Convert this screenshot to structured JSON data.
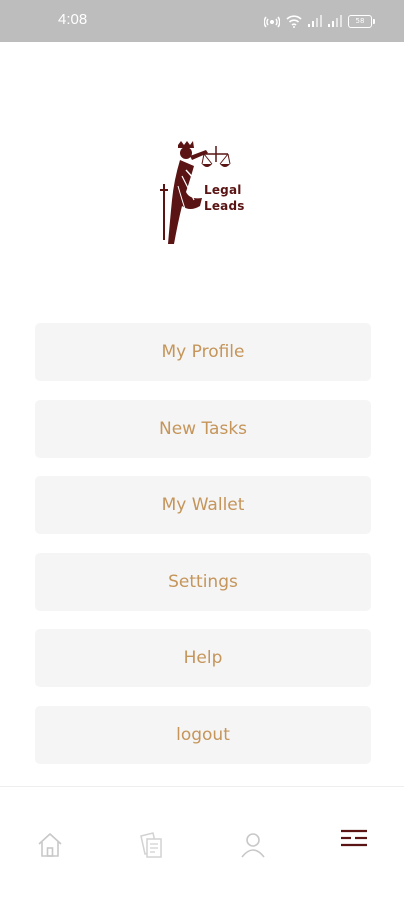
{
  "status_bar": {
    "time": "4:08",
    "battery": "58"
  },
  "logo": {
    "line1": "Legal",
    "line2": "Leads"
  },
  "menu": {
    "items": [
      {
        "label": "My Profile"
      },
      {
        "label": "New Tasks"
      },
      {
        "label": "My Wallet"
      },
      {
        "label": "Settings"
      },
      {
        "label": "Help"
      },
      {
        "label": "logout"
      }
    ]
  },
  "bottom_nav": {
    "items": [
      {
        "icon": "home-icon",
        "active": false
      },
      {
        "icon": "documents-icon",
        "active": false
      },
      {
        "icon": "person-icon",
        "active": false
      },
      {
        "icon": "menu-lines-icon",
        "active": true
      }
    ]
  },
  "colors": {
    "accent_text": "#c5955a",
    "brand": "#5a1414",
    "button_bg": "#f5f5f5",
    "status_bar": "#bdbdbd",
    "nav_inactive": "#c8c8c8",
    "nav_active": "#5a1414"
  }
}
